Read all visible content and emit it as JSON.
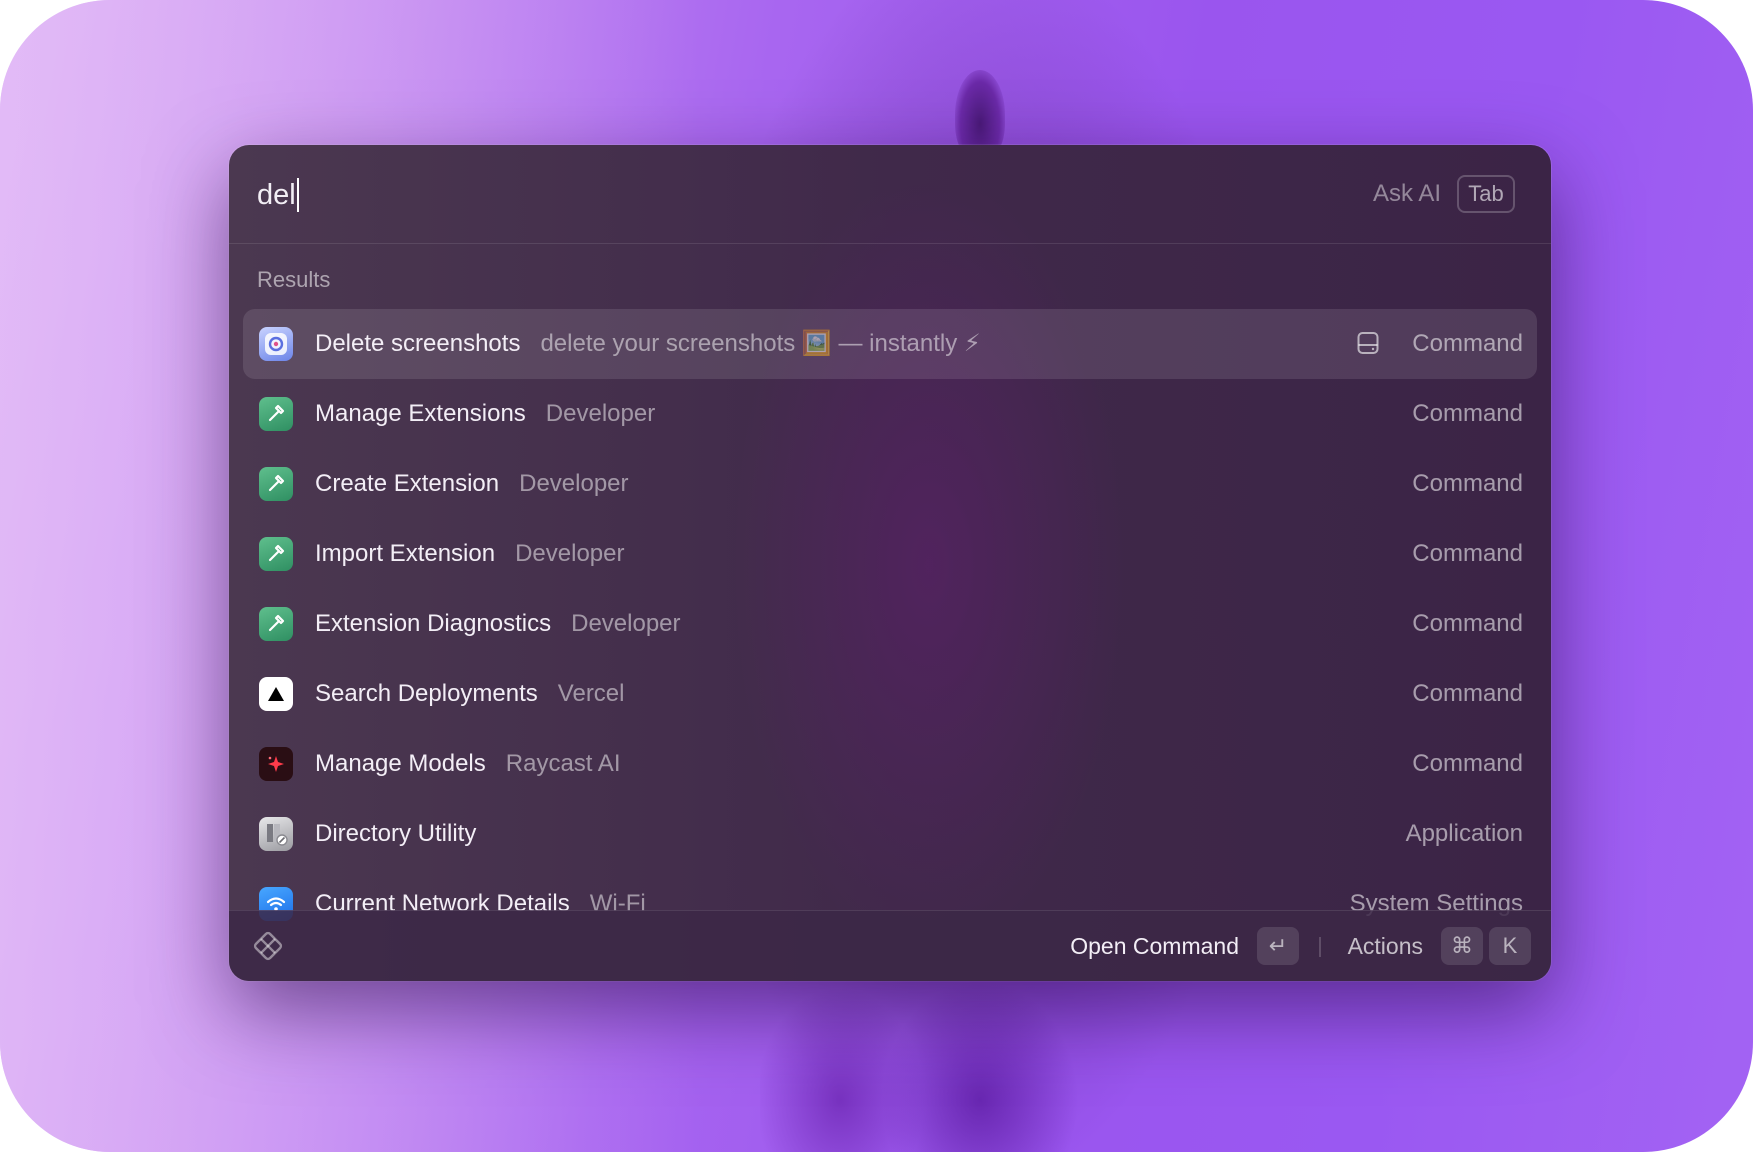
{
  "search": {
    "value": "del",
    "ask_ai_label": "Ask AI",
    "ask_ai_key": "Tab"
  },
  "section": {
    "title": "Results"
  },
  "results": [
    {
      "title": "Delete screenshots",
      "subtitle": "delete your screenshots 🖼️ — instantly ⚡",
      "type": "Command",
      "icon": "screenshot-icon",
      "selected": true
    },
    {
      "title": "Manage Extensions",
      "subtitle": "Developer",
      "type": "Command",
      "icon": "developer-hammer-icon"
    },
    {
      "title": "Create Extension",
      "subtitle": "Developer",
      "type": "Command",
      "icon": "developer-hammer-icon"
    },
    {
      "title": "Import Extension",
      "subtitle": "Developer",
      "type": "Command",
      "icon": "developer-hammer-icon"
    },
    {
      "title": "Extension Diagnostics",
      "subtitle": "Developer",
      "type": "Command",
      "icon": "developer-hammer-icon"
    },
    {
      "title": "Search Deployments",
      "subtitle": "Vercel",
      "type": "Command",
      "icon": "vercel-triangle-icon"
    },
    {
      "title": "Manage Models",
      "subtitle": "Raycast AI",
      "type": "Command",
      "icon": "raycast-ai-sparkle-icon"
    },
    {
      "title": "Directory Utility",
      "subtitle": "",
      "type": "Application",
      "icon": "directory-utility-icon"
    },
    {
      "title": "Current Network Details",
      "subtitle": "Wi-Fi",
      "type": "System Settings",
      "icon": "wifi-icon"
    }
  ],
  "footer": {
    "primary_action": "Open Command",
    "enter_key": "↵",
    "actions_label": "Actions",
    "cmd_key": "⌘",
    "k_key": "K"
  },
  "colors": {
    "background_accent": "#9a55ee",
    "window_bg": "#40294a",
    "developer_icon": "#3d9a6b"
  }
}
